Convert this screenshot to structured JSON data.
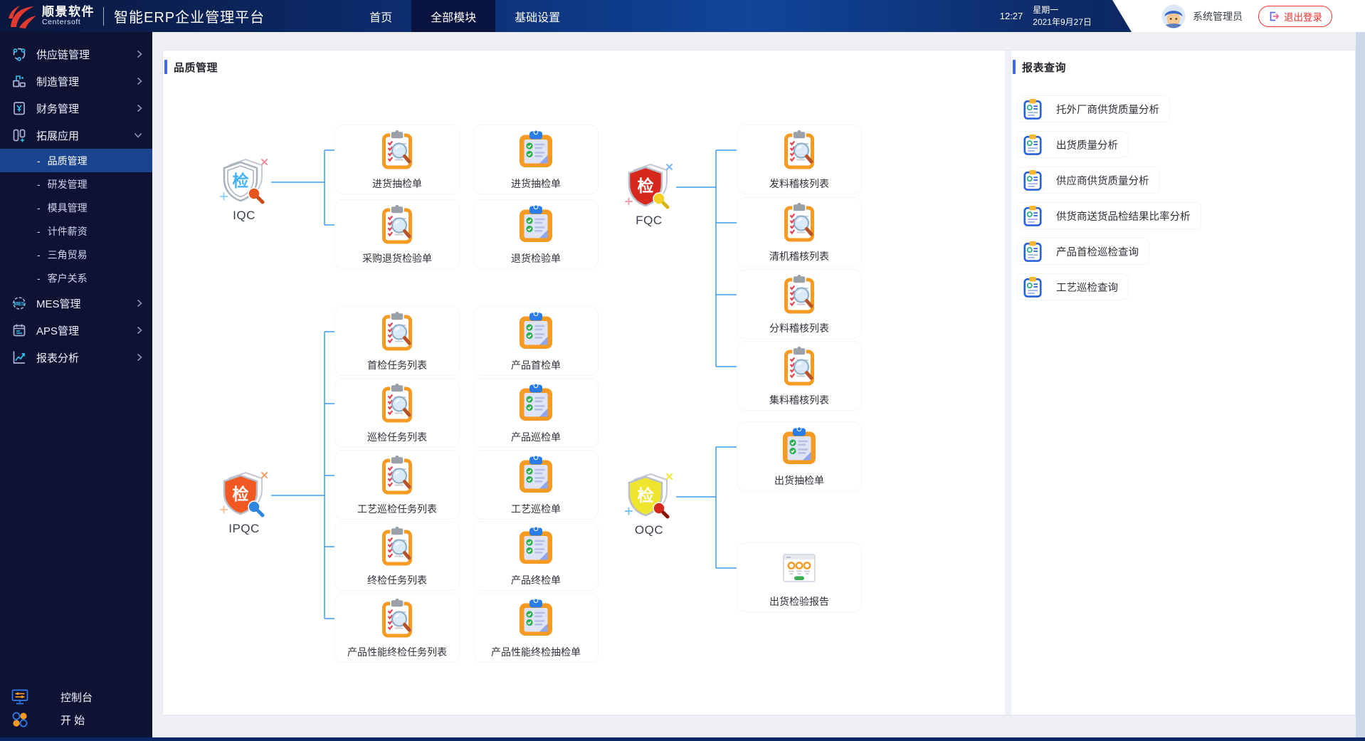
{
  "topbar": {
    "logo_title": "顺景软件",
    "logo_subtitle": "Centersoft",
    "app_title": "智能ERP企业管理平台",
    "nav": [
      {
        "name": "home",
        "label": "首页",
        "active": false
      },
      {
        "name": "all-modules",
        "label": "全部模块",
        "active": true
      },
      {
        "name": "basic-settings",
        "label": "基础设置",
        "active": false
      }
    ],
    "time": "12:27",
    "weekday": "星期一",
    "date": "2021年9月27日",
    "user_name": "系统管理员",
    "logout_label": "退出登录",
    "avatar_icon": "user-avatar-icon",
    "logout_icon": "logout-icon"
  },
  "sidebar": {
    "bullet_char": "-",
    "items": [
      {
        "name": "supply-chain",
        "label": "供应链管理",
        "icon": "supply-chain-icon",
        "chevron": "right"
      },
      {
        "name": "manufacturing",
        "label": "制造管理",
        "icon": "manufacturing-icon",
        "chevron": "right"
      },
      {
        "name": "finance",
        "label": "财务管理",
        "icon": "finance-icon",
        "chevron": "right"
      },
      {
        "name": "extensions",
        "label": "拓展应用",
        "icon": "extensions-icon",
        "chevron": "down",
        "expanded": true,
        "children": [
          {
            "name": "quality",
            "label": "品质管理",
            "active": true
          },
          {
            "name": "rnd",
            "label": "研发管理",
            "active": false
          },
          {
            "name": "mold",
            "label": "模具管理",
            "active": false
          },
          {
            "name": "piece-salary",
            "label": "计件薪资",
            "active": false
          },
          {
            "name": "triangle-trade",
            "label": "三角贸易",
            "active": false
          },
          {
            "name": "customer-relations",
            "label": "客户关系",
            "active": false
          }
        ]
      },
      {
        "name": "mes",
        "label": "MES管理",
        "icon": "mes-icon",
        "chevron": "right"
      },
      {
        "name": "aps",
        "label": "APS管理",
        "icon": "aps-icon",
        "chevron": "right"
      },
      {
        "name": "report-analysis",
        "label": "报表分析",
        "icon": "report-analysis-icon",
        "chevron": "right"
      }
    ],
    "footer": [
      {
        "name": "console",
        "label": "控制台",
        "icon": "console-icon"
      },
      {
        "name": "start",
        "label": "开 始",
        "icon": "start-icon"
      }
    ]
  },
  "main": {
    "section_title": "品质管理",
    "flow_groups": [
      {
        "id": "iqc",
        "label": "IQC",
        "shield_char": "检",
        "shield_style": "outline-blue",
        "rows": [
          [
            {
              "label": "进货抽检单",
              "icon": "clipboard-inspect-icon"
            },
            {
              "label": "进货抽检单",
              "icon": "clipboard-form-icon"
            }
          ],
          [
            {
              "label": "采购退货检验单",
              "icon": "clipboard-inspect-icon"
            },
            {
              "label": "退货检验单",
              "icon": "clipboard-form-icon"
            }
          ]
        ]
      },
      {
        "id": "ipqc",
        "label": "IPQC",
        "shield_char": "检",
        "shield_style": "orange",
        "rows": [
          [
            {
              "label": "首检任务列表",
              "icon": "clipboard-inspect-icon"
            },
            {
              "label": "产品首检单",
              "icon": "clipboard-form-icon"
            }
          ],
          [
            {
              "label": "巡检任务列表",
              "icon": "clipboard-inspect-icon"
            },
            {
              "label": "产品巡检单",
              "icon": "clipboard-form-icon"
            }
          ],
          [
            {
              "label": "工艺巡检任务列表",
              "icon": "clipboard-inspect-icon"
            },
            {
              "label": "工艺巡检单",
              "icon": "clipboard-form-icon"
            }
          ],
          [
            {
              "label": "终检任务列表",
              "icon": "clipboard-inspect-icon"
            },
            {
              "label": "产品终检单",
              "icon": "clipboard-form-icon"
            }
          ],
          [
            {
              "label": "产品性能终检任务列表",
              "icon": "clipboard-inspect-icon"
            },
            {
              "label": "产品性能终检抽检单",
              "icon": "clipboard-form-icon"
            }
          ]
        ]
      },
      {
        "id": "fqc",
        "label": "FQC",
        "shield_char": "检",
        "shield_style": "red",
        "rows": [
          [
            {
              "label": "发料稽核列表",
              "icon": "clipboard-inspect-icon"
            }
          ],
          [
            {
              "label": "清机稽核列表",
              "icon": "clipboard-inspect-icon"
            }
          ],
          [
            {
              "label": "分料稽核列表",
              "icon": "clipboard-inspect-icon"
            }
          ],
          [
            {
              "label": "集料稽核列表",
              "icon": "clipboard-inspect-icon"
            }
          ]
        ]
      },
      {
        "id": "oqc",
        "label": "OQC",
        "shield_char": "检",
        "shield_style": "yellow",
        "rows": [
          [
            {
              "label": "出货抽检单",
              "icon": "clipboard-form-icon"
            }
          ],
          [
            {
              "label": "出货检验报告",
              "icon": "report-icon"
            }
          ]
        ]
      }
    ]
  },
  "report_panel": {
    "title": "报表查询",
    "items": [
      {
        "label": "托外厂商供货质量分析",
        "icon": "report-query-icon"
      },
      {
        "label": "出货质量分析",
        "icon": "report-query-icon"
      },
      {
        "label": "供应商供货质量分析",
        "icon": "report-query-icon"
      },
      {
        "label": "供货商送货品检结果比率分析",
        "icon": "report-query-icon"
      },
      {
        "label": "产品首检巡检查询",
        "icon": "report-query-icon"
      },
      {
        "label": "工艺巡检查询",
        "icon": "report-query-icon"
      }
    ]
  },
  "colors": {
    "topbar_blue": "#10459a",
    "active_tab": "#0a1440",
    "sidebar_navy": "#0e1233",
    "selected_blue": "#1b448f",
    "accent_blue": "#4066f0",
    "arrow_blue": "#3f9bf0",
    "clipboard_orange": "#f59a23",
    "shield_red": "#d7281d",
    "shield_orange": "#f15822",
    "shield_yellow": "#efe52e",
    "green": "#2daf4d",
    "logout_red": "#e5342e"
  }
}
